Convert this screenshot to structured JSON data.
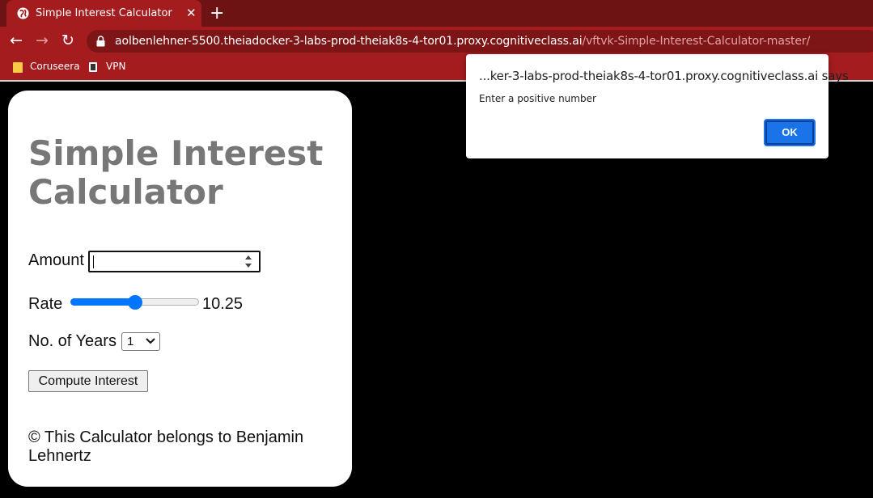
{
  "browser": {
    "tab_title": "Simple Interest Calculator",
    "tab_close": "✕",
    "new_tab": "+",
    "back": "←",
    "forward": "→",
    "reload": "↻",
    "url_host": "aolbenlehner-5500.theiadocker-3-labs-prod-theiak8s-4-tor01.proxy.cognitiveclass.ai",
    "url_path": "/vftvk-Simple-Interest-Calculator-master/",
    "bookmarks": [
      "Coruseera",
      "VPN"
    ],
    "theme_color": "#a51c1f"
  },
  "calculator": {
    "title": "Simple Interest Calculator",
    "amount_label": "Amount",
    "amount_value": "",
    "rate_label": "Rate",
    "rate_value": "10.25",
    "rate_slider_fraction": 0.5,
    "years_label": "No. of Years",
    "years_selected": "1",
    "compute_label": "Compute Interest",
    "footer": "© This Calculator belongs to Benjamin Lehnertz"
  },
  "alert": {
    "title": "...ker-3-labs-prod-theiak8s-4-tor01.proxy.cognitiveclass.ai says",
    "message": "Enter a positive number",
    "ok_label": "OK",
    "accent": "#1a73e8"
  }
}
